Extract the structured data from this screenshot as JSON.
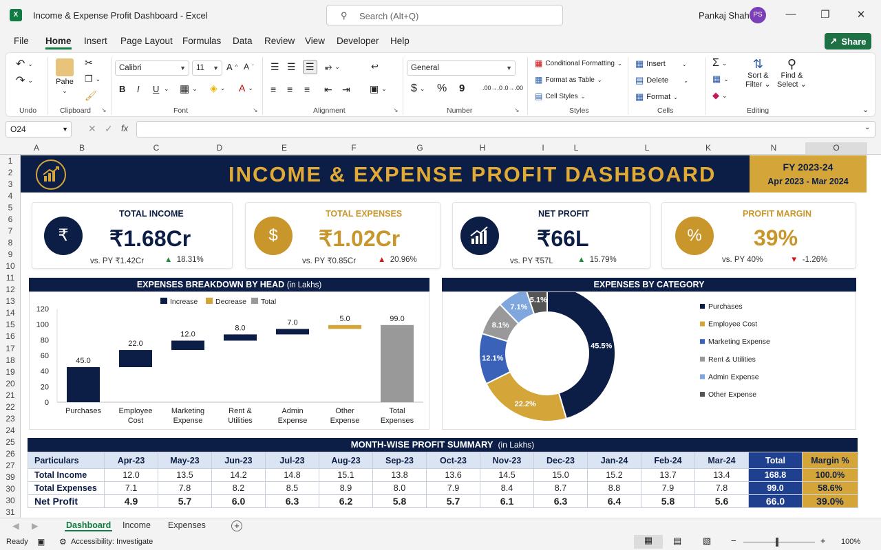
{
  "window": {
    "title": "Income & Expense Profit Dashboard  -  Excel",
    "user": "Pankaj Shah",
    "avatar": "PS",
    "search_placeholder": "Search (Alt+Q)"
  },
  "menu": [
    "File",
    "Home",
    "Insert",
    "Page Layout",
    "Formulas",
    "Data",
    "Review",
    "View",
    "Developer",
    "Help"
  ],
  "share_label": "Share",
  "ribbon": {
    "undo_label": "Undo",
    "clipboard": {
      "paste": "Pahe",
      "label": "Clipboard"
    },
    "font": {
      "name": "Calibri",
      "size": "11",
      "label": "Font",
      "bold": "B",
      "italic": "I",
      "underline": "U"
    },
    "alignment_label": "Alignment",
    "number": {
      "format": "General",
      "label": "Number",
      "currency": "$",
      "percent": "%",
      "comma": "9",
      "inc_dec": ".00→.0",
      "dec_dec": ".0→.00"
    },
    "styles": {
      "conditional": "Conditional Formatting",
      "table": "Format as Table",
      "cell": "Cell Styles",
      "label": "Styles"
    },
    "cells": {
      "insert": "Insert",
      "delete": "Delete",
      "format": "Format",
      "label": "Cells"
    },
    "editing": {
      "sort": "Sort &",
      "filter": "Filter",
      "find": "Find &",
      "select": "Select",
      "label": "Editing"
    }
  },
  "formula_bar": {
    "name_box": "O24",
    "fx": "fx",
    "value": ""
  },
  "columns": [
    "A",
    "B",
    "C",
    "D",
    "E",
    "F",
    "G",
    "H",
    "I",
    "L",
    "L",
    "K",
    "N",
    "O"
  ],
  "rows": [
    "1",
    "2",
    "3",
    "4",
    "5",
    "6",
    "7",
    "8",
    "9",
    "10",
    "11",
    "12",
    "13",
    "14",
    "15",
    "16",
    "17",
    "18",
    "19",
    "20",
    "21",
    "22",
    "23",
    "24",
    "25",
    "26",
    "27",
    "39",
    "30",
    "30",
    "31"
  ],
  "banner": {
    "title": "INCOME & EXPENSE PROFIT DASHBOARD",
    "fy": "FY  2023-24",
    "period": "Apr 2023 - Mar 2024"
  },
  "kpis": [
    {
      "label": "TOTAL INCOME",
      "value": "₹1.68Cr",
      "py": "vs. PY  ₹1.42Cr",
      "change": "18.31%",
      "dir": "up",
      "icon": "rupee-hand-icon",
      "glyph": "₹",
      "color": "#0d1e46",
      "label_color": "#0d1e46"
    },
    {
      "label": "TOTAL EXPENSES",
      "value": "₹1.02Cr",
      "py": "vs. PY  ₹0.85Cr",
      "change": "20.96%",
      "dir": "down",
      "icon": "receipt-icon",
      "glyph": "$",
      "color": "#c9962b",
      "label_color": "#c9962b"
    },
    {
      "label": "NET PROFIT",
      "value": "₹66L",
      "py": "vs. PY  ₹57L",
      "change": "15.79%",
      "dir": "up",
      "icon": "bar-growth-icon",
      "glyph": "↗",
      "color": "#0d1e46",
      "label_color": "#0d1e46"
    },
    {
      "label": "PROFIT MARGIN",
      "value": "39%",
      "py": "vs. PY  40%",
      "change": "-1.26%",
      "dir": "down",
      "icon": "percent-gear-icon",
      "glyph": "%",
      "color": "#c9962b",
      "label_color": "#c9962b"
    }
  ],
  "waterfall": {
    "title": "EXPENSES BREAKDOWN BY HEAD",
    "subtitle": "(in Lakhs)",
    "legend": [
      "Increase",
      "Decrease",
      "Total"
    ],
    "colors": {
      "increase": "#0d1e46",
      "decrease": "#d4a63a",
      "total": "#999999"
    }
  },
  "donut": {
    "title": "EXPENSES BY CATEGORY",
    "legend_colors": [
      "#0d1e46",
      "#d4a63a",
      "#3a62b8",
      "#999999",
      "#7fa7dd",
      "#555555"
    ]
  },
  "chart_data": [
    {
      "type": "bar",
      "categories": [
        "Purchases",
        "Employee Cost",
        "Marketing Expense",
        "Rent & Utilities",
        "Admin Expense",
        "Other Expense",
        "Total Expenses"
      ],
      "category_lines": [
        [
          "Purchases"
        ],
        [
          "Employee",
          "Cost"
        ],
        [
          "Marketing",
          "Expense"
        ],
        [
          "Rent &",
          "Utilities"
        ],
        [
          "Admin",
          "Expense"
        ],
        [
          "Other",
          "Expense"
        ],
        [
          "Total",
          "Expenses"
        ]
      ],
      "values": [
        45.0,
        22.0,
        12.0,
        8.0,
        7.0,
        5.0,
        99.0
      ],
      "labels": [
        "45.0",
        "22.0",
        "12.0",
        "8.0",
        "7.0",
        "5.0",
        "99.0"
      ],
      "kinds": [
        "increase",
        "increase",
        "increase",
        "increase",
        "increase",
        "decrease",
        "total"
      ],
      "yticks": [
        0,
        20,
        40,
        60,
        80,
        100,
        120
      ],
      "ylim": [
        0,
        120
      ],
      "legend": "top-center"
    },
    {
      "type": "pie",
      "categories": [
        "Purchases",
        "Employee Cost",
        "Marketing Expense",
        "Rent & Utilities",
        "Admin Expense",
        "Other Expense"
      ],
      "values": [
        45.5,
        22.2,
        12.1,
        8.1,
        7.1,
        5.1
      ],
      "labels": [
        "45.5%",
        "22.2%",
        "12.1%",
        "8.1%",
        "7.1%",
        "5.1%"
      ],
      "legend": "right"
    }
  ],
  "summary": {
    "title": "MONTH-WISE PROFIT SUMMARY",
    "subtitle": "(in Lakhs)",
    "headers": [
      "Particulars",
      "Apr-23",
      "May-23",
      "Jun-23",
      "Jul-23",
      "Aug-23",
      "Sep-23",
      "Oct-23",
      "Nov-23",
      "Dec-23",
      "Jan-24",
      "Feb-24",
      "Mar-24",
      "Total",
      "Margin %"
    ],
    "rows": [
      [
        "Total Income",
        "12.0",
        "13.5",
        "14.2",
        "14.8",
        "15.1",
        "13.8",
        "13.6",
        "14.5",
        "15.0",
        "15.2",
        "13.7",
        "13.4",
        "168.8",
        "100.0%"
      ],
      [
        "Total Expenses",
        "7.1",
        "7.8",
        "8.2",
        "8.5",
        "8.9",
        "8.0",
        "7.9",
        "8.4",
        "8.7",
        "8.8",
        "7.9",
        "7.8",
        "99.0",
        "58.6%"
      ],
      [
        "Net Profit",
        "4.9",
        "5.7",
        "6.0",
        "6.3",
        "6.2",
        "5.8",
        "5.7",
        "6.1",
        "6.3",
        "6.4",
        "5.8",
        "5.6",
        "66.0",
        "39.0%"
      ]
    ]
  },
  "sheet_tabs": [
    "Dashboard",
    "Income",
    "Expenses"
  ],
  "status": {
    "ready": "Ready",
    "accessibility": "Accessibility: Investigate",
    "zoom": "100%"
  }
}
